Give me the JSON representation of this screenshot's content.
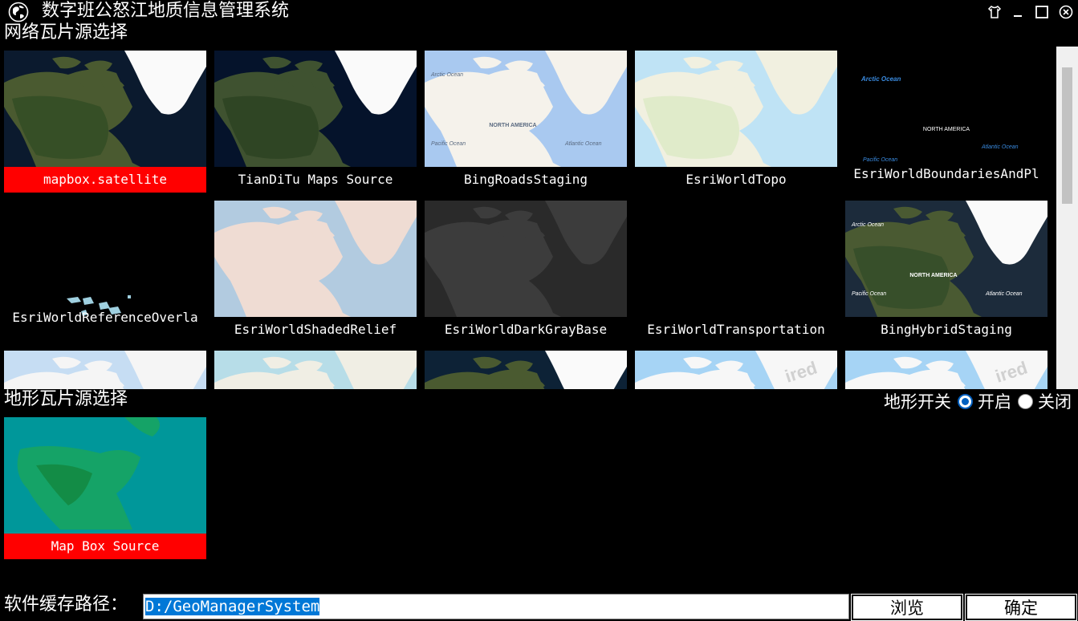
{
  "window": {
    "title": "数字班公怒江地质信息管理系统",
    "controls": [
      "shirt-icon",
      "minimize-icon",
      "maximize-icon",
      "close-icon"
    ]
  },
  "network_section": {
    "title": "网络瓦片源选择",
    "tiles": [
      {
        "label": "mapbox.satellite",
        "selected": true,
        "style": "satellite"
      },
      {
        "label": "TianDiTu Maps Source",
        "selected": false,
        "style": "satellite-dark"
      },
      {
        "label": "BingRoadsStaging",
        "selected": false,
        "style": "road-light"
      },
      {
        "label": "EsriWorldTopo",
        "selected": false,
        "style": "topo"
      },
      {
        "label": "EsriWorldBoundariesAndPl",
        "selected": false,
        "style": "boundaries"
      },
      {
        "label": "EsriWorldReferenceOverla",
        "selected": false,
        "style": "reference"
      },
      {
        "label": "EsriWorldShadedRelief",
        "selected": false,
        "style": "shaded"
      },
      {
        "label": "EsriWorldDarkGrayBase",
        "selected": false,
        "style": "darkgray"
      },
      {
        "label": "EsriWorldTransportation",
        "selected": false,
        "style": "blank"
      },
      {
        "label": "BingHybridStaging",
        "selected": false,
        "style": "hybrid"
      },
      {
        "label": "",
        "selected": false,
        "style": "topo-partial"
      },
      {
        "label": "",
        "selected": false,
        "style": "light-partial"
      },
      {
        "label": "",
        "selected": false,
        "style": "sat-partial"
      },
      {
        "label": "",
        "selected": false,
        "style": "expired-partial"
      },
      {
        "label": "",
        "selected": false,
        "style": "expired-partial"
      }
    ],
    "map_labels": {
      "north_america": "NORTH AMERICA",
      "arctic_ocean": "Arctic Ocean",
      "atlantic_ocean": "Atlantic Ocean",
      "pacific_ocean": "Pacific Ocean",
      "expired": "ired"
    }
  },
  "terrain_section": {
    "title": "地形瓦片源选择",
    "toggle_label": "地形开关",
    "on_label": "开启",
    "off_label": "关闭",
    "enabled": true,
    "tiles": [
      {
        "label": "Map Box Source",
        "selected": true,
        "style": "terrain"
      }
    ]
  },
  "cache": {
    "label": "软件缓存路径：",
    "value": "D:/GeoManagerSystem",
    "browse_label": "浏览",
    "ok_label": "确定"
  },
  "colors": {
    "selected": "#ff0000",
    "background": "#000000",
    "radio_accent": "#0060c0"
  }
}
